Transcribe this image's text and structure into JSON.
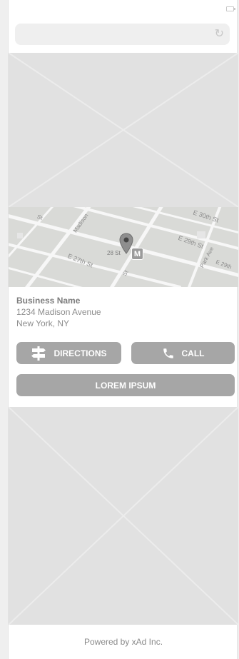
{
  "business": {
    "name": "Business Name",
    "address_line1": "1234 Madison Avenue",
    "address_line2": "New York, NY"
  },
  "buttons": {
    "directions_label": "DIRECTIONS",
    "call_label": "CALL",
    "lorem_label": "LOREM IPSUM"
  },
  "map": {
    "street_labels": [
      "E 30th St",
      "E 29th St",
      "E 27th St",
      "28 St",
      "Madison",
      "Park Ave",
      "E 29th",
      "St",
      "St"
    ],
    "subway_label": "M"
  },
  "footer": {
    "text": "Powered by xAd Inc."
  },
  "icons": {
    "battery": "battery-icon",
    "reload": "reload-icon",
    "directions": "signpost-icon",
    "call": "phone-icon",
    "pin": "map-pin-icon"
  },
  "colors": {
    "button": "#a6a6a6",
    "placeholder": "#e1e1e1",
    "map_bg": "#d9dad7",
    "text": "#8d8d8d"
  }
}
